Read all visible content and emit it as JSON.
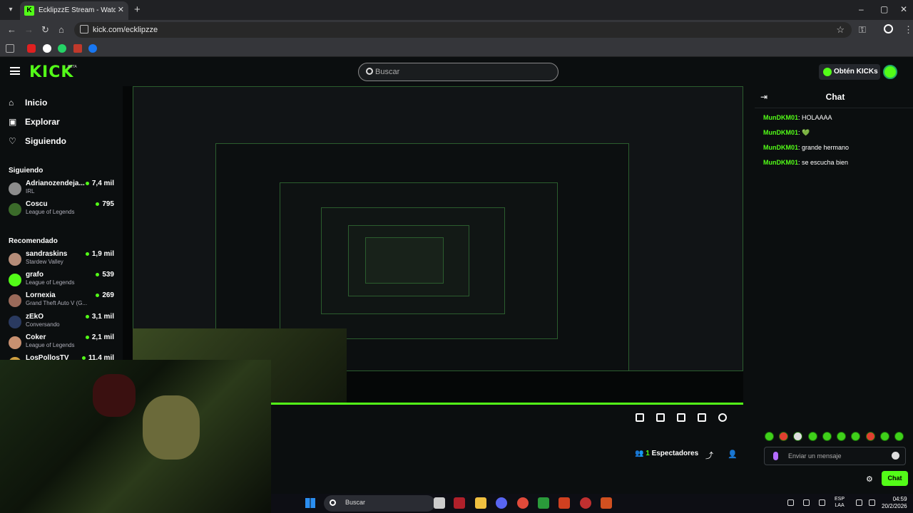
{
  "browser": {
    "tab_title": "EcklipzzE Stream - Watch Live o",
    "url": "kick.com/ecklipzze",
    "window_controls": [
      "–",
      "▢",
      "✕"
    ]
  },
  "header": {
    "logo": "KICK",
    "logo_badge": "BETA",
    "search_placeholder": "Buscar",
    "kicks_button": "Obtén KICKs"
  },
  "sidebar": {
    "nav": [
      {
        "label": "Inicio",
        "icon": "home-icon"
      },
      {
        "label": "Explorar",
        "icon": "explore-icon"
      },
      {
        "label": "Siguiendo",
        "icon": "heart-icon"
      }
    ],
    "following_title": "Siguiendo",
    "following": [
      {
        "name": "Adrianozendeja...",
        "category": "IRL",
        "viewers": "7,4 mil",
        "color": "#8c8c8c"
      },
      {
        "name": "Coscu",
        "category": "League of Legends",
        "viewers": "795",
        "color": "#3b6b2a"
      }
    ],
    "recommended_title": "Recomendado",
    "recommended": [
      {
        "name": "sandraskins",
        "category": "Stardew Valley",
        "viewers": "1,9 mil",
        "color": "#b58c78"
      },
      {
        "name": "grafo",
        "category": "League of Legends",
        "viewers": "539",
        "color": "#53fc18"
      },
      {
        "name": "Lornexia",
        "category": "Grand Theft Auto V (G...",
        "viewers": "269",
        "color": "#9a6a5a"
      },
      {
        "name": "zEkO",
        "category": "Conversando",
        "viewers": "3,1 mil",
        "color": "#2a3a60"
      },
      {
        "name": "Coker",
        "category": "League of Legends",
        "viewers": "2,1 mil",
        "color": "#c89070"
      },
      {
        "name": "LosPollosTV",
        "category": "",
        "viewers": "11,4 mil",
        "color": "#d0a040"
      }
    ]
  },
  "stream": {
    "viewers_count": "1",
    "viewers_label": "Espectadores"
  },
  "chat": {
    "title": "Chat",
    "messages": [
      {
        "user": "MunDKM01",
        "text": "HOLAAAA"
      },
      {
        "user": "MunDKM01",
        "text": "💚"
      },
      {
        "user": "MunDKM01",
        "text": "grande hermano"
      },
      {
        "user": "MunDKM01",
        "text": "se escucha bien"
      }
    ],
    "input_placeholder": "Enviar un mensaje",
    "send_label": "Chat"
  },
  "taskbar": {
    "search_label": "Buscar",
    "lang_1": "ESP",
    "lang_2": "LAA",
    "time": "04:59",
    "date": "20/2/2026"
  },
  "colors": {
    "accent": "#53fc18",
    "bg": "#0b0e0f"
  }
}
